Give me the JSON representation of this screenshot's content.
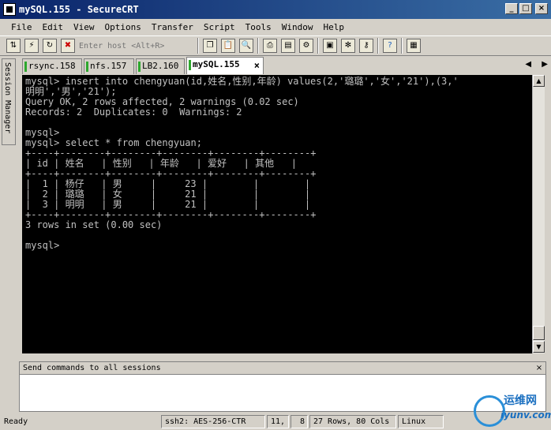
{
  "window": {
    "title": "mySQL.155 - SecureCRT"
  },
  "menu": [
    "File",
    "Edit",
    "View",
    "Options",
    "Transfer",
    "Script",
    "Tools",
    "Window",
    "Help"
  ],
  "toolbar": {
    "host_placeholder": "Enter host <Alt+R>"
  },
  "session_manager": {
    "label": "Session Manager"
  },
  "tabs": [
    {
      "label": "rsync.158",
      "active": false
    },
    {
      "label": "nfs.157",
      "active": false
    },
    {
      "label": "LB2.160",
      "active": false
    },
    {
      "label": "mySQL.155",
      "active": true
    }
  ],
  "terminal": {
    "lines": [
      "mysql> insert into chengyuan(id,姓名,性别,年龄) values(2,'璐璐','女','21'),(3,'",
      "明明','男','21');",
      "Query OK, 2 rows affected, 2 warnings (0.02 sec)",
      "Records: 2  Duplicates: 0  Warnings: 2",
      "",
      "mysql>",
      "mysql> select * from chengyuan;",
      "+----+--------+--------+--------+--------+--------+",
      "| id | 姓名   | 性别   | 年龄   | 爱好   | 其他   |",
      "+----+--------+--------+--------+--------+--------+",
      "|  1 | 杨仔   | 男     |     23 |        |        |",
      "|  2 | 璐璐   | 女     |     21 |        |        |",
      "|  3 | 明明   | 男     |     21 |        |        |",
      "+----+--------+--------+--------+--------+--------+",
      "3 rows in set (0.00 sec)",
      "",
      "mysql>"
    ]
  },
  "command_panel": {
    "header": "Send commands to all sessions"
  },
  "statusbar": {
    "ready": "Ready",
    "cipher": "ssh2: AES-256-CTR",
    "row": "11,",
    "col": "8",
    "size": "27 Rows, 80 Cols",
    "term": "Linux"
  },
  "watermark": {
    "brand": "运维网",
    "domain": "iyunv.com"
  }
}
